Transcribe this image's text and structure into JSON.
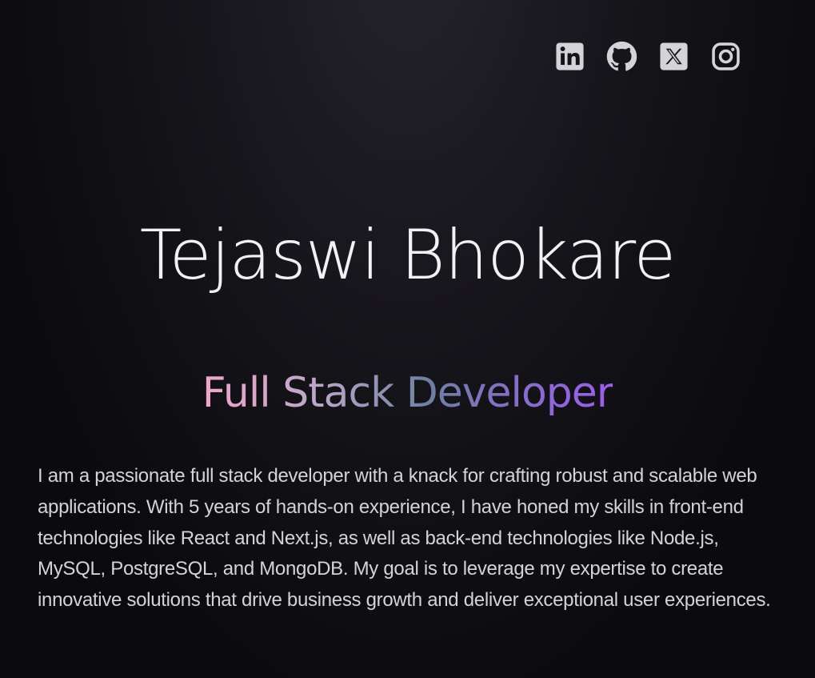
{
  "social": [
    {
      "name": "LinkedIn",
      "icon": "linkedin-icon"
    },
    {
      "name": "GitHub",
      "icon": "github-icon"
    },
    {
      "name": "X",
      "icon": "x-icon"
    },
    {
      "name": "Instagram",
      "icon": "instagram-icon"
    }
  ],
  "hero": {
    "name": "Tejaswi Bhokare",
    "role": "Full Stack Developer",
    "about": "I am a passionate full stack developer with a knack for crafting robust and scalable web applications. With 5 years of hands-on experience, I have honed my skills in front-end technologies like React and Next.js, as well as back-end technologies like Node.js, MySQL, PostgreSQL, and MongoDB. My goal is to leverage my expertise to create innovative solutions that drive business growth and deliver exceptional user experiences."
  },
  "colors": {
    "background": "#0b0b0d",
    "text": "#d4d4d8",
    "gradient_start": "#f0a6ca",
    "gradient_end": "#9c5cf0"
  }
}
